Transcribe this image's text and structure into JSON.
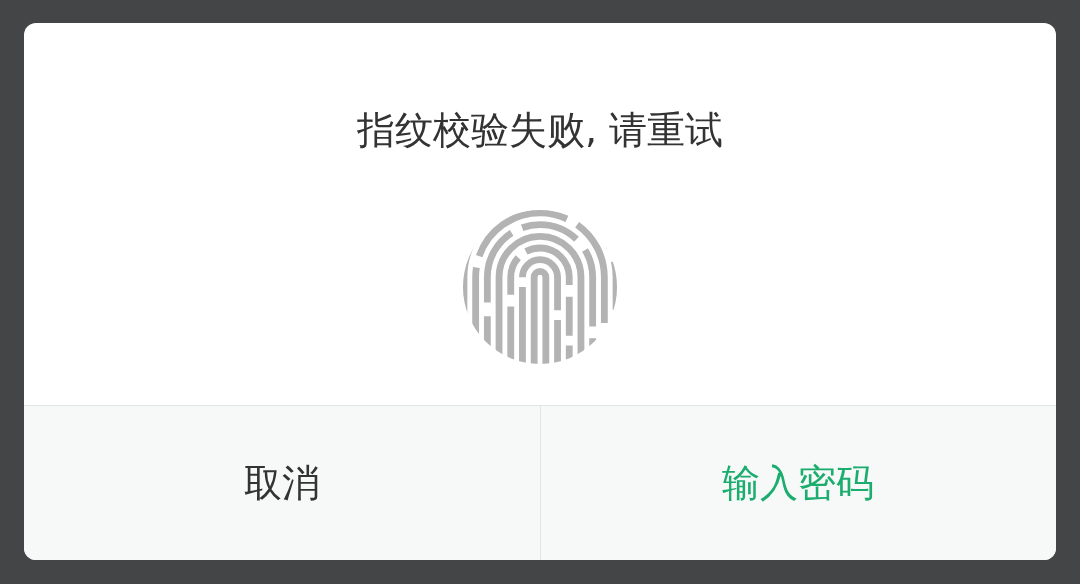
{
  "dialog": {
    "title": "指纹校验失败, 请重试",
    "buttons": [
      {
        "label": "取消",
        "kind": "cancel"
      },
      {
        "label": "输入密码",
        "kind": "primary"
      }
    ]
  }
}
